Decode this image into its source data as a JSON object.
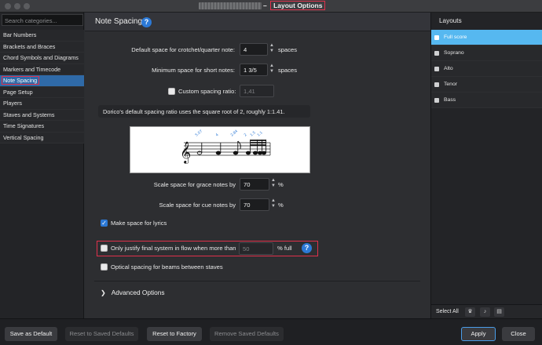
{
  "window": {
    "title": "Layout Options"
  },
  "sidebar": {
    "search_placeholder": "Search categories...",
    "categories": [
      "Bar Numbers",
      "Brackets and Braces",
      "Chord Symbols and Diagrams",
      "Markers and Timecode",
      "Note Spacing",
      "Page Setup",
      "Players",
      "Staves and Systems",
      "Time Signatures",
      "Vertical Spacing"
    ],
    "active": "Note Spacing"
  },
  "main": {
    "title": "Note Spacing",
    "default_space": {
      "label": "Default space for crotchet/quarter note:",
      "value": "4",
      "unit": "spaces"
    },
    "min_space": {
      "label": "Minimum space for short notes:",
      "value": "1 3/5",
      "unit": "spaces"
    },
    "custom_ratio": {
      "label": "Custom spacing ratio:",
      "value": "1,41",
      "checked": false
    },
    "ratio_note": "Dorico's default spacing ratio uses the square root of 2, roughly 1:1.41.",
    "music_example": {
      "labels": [
        "5.07",
        "4",
        "2.84",
        "2",
        "1.5",
        "1.1"
      ]
    },
    "grace_scale": {
      "label": "Scale space for grace notes by",
      "value": "70",
      "unit": "%"
    },
    "cue_scale": {
      "label": "Scale space for cue notes by",
      "value": "70",
      "unit": "%"
    },
    "lyrics": {
      "label": "Make space for lyrics",
      "checked": true
    },
    "justify": {
      "label": "Only justify final system in flow when more than",
      "value": "50",
      "unit": "% full",
      "checked": false
    },
    "optical": {
      "label": "Optical spacing for beams between staves",
      "checked": false
    },
    "advanced": "Advanced Options"
  },
  "layouts": {
    "title": "Layouts",
    "items": [
      "Full score",
      "Soprano",
      "Alto",
      "Tenor",
      "Bass"
    ],
    "selected": "Full score",
    "select_all": "Select All"
  },
  "footer": {
    "save_default": "Save as Default",
    "reset_saved": "Reset to Saved Defaults",
    "reset_factory": "Reset to Factory",
    "remove_saved": "Remove Saved Defaults",
    "apply": "Apply",
    "close": "Close"
  },
  "colors": {
    "accent": "#2c79d6",
    "highlight": "#e0314b",
    "selected_layout": "#56b8f0"
  }
}
